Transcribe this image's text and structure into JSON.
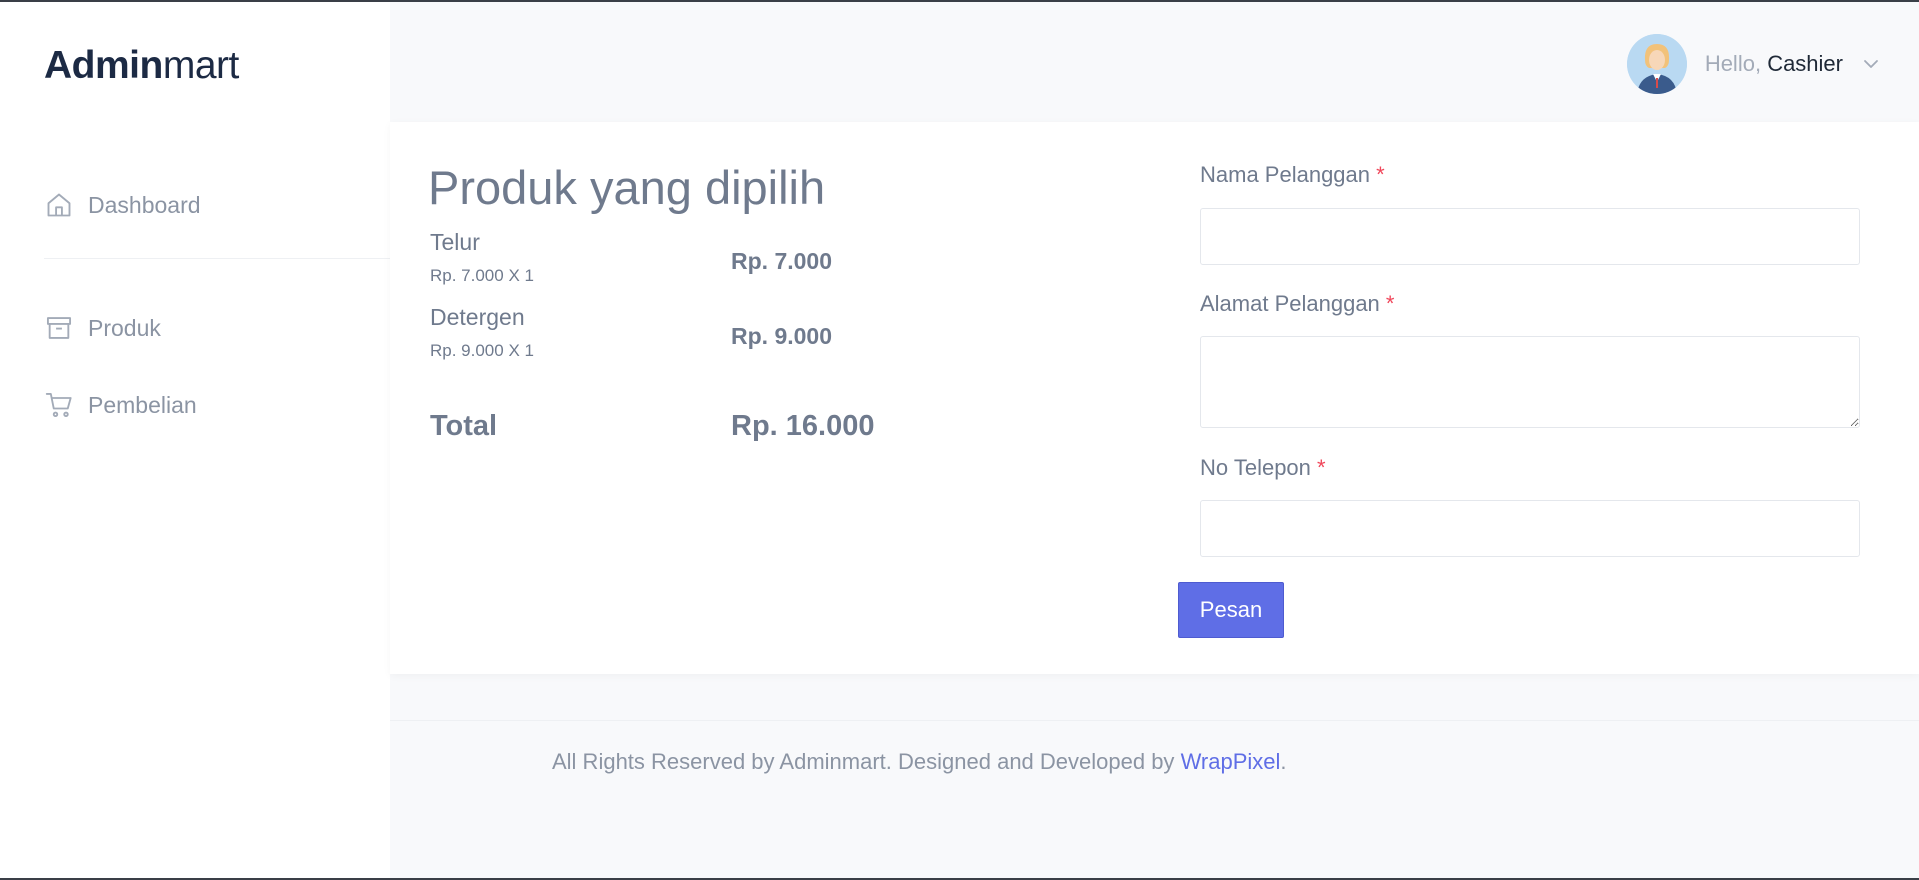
{
  "brand": {
    "bold": "Admin",
    "light": "mart"
  },
  "sidebar": {
    "items": [
      {
        "label": "Dashboard",
        "icon": "home-icon"
      },
      {
        "label": "Produk",
        "icon": "archive-box-icon"
      },
      {
        "label": "Pembelian",
        "icon": "cart-icon"
      }
    ]
  },
  "header": {
    "greeting": "Hello,",
    "user_name": "Cashier",
    "avatar_icon": "user-avatar-icon",
    "dropdown_icon": "chevron-down-icon"
  },
  "order": {
    "title": "Produk yang dipilih",
    "items": [
      {
        "name": "Telur",
        "qty_line": "Rp. 7.000 X 1",
        "subtotal": "Rp. 7.000"
      },
      {
        "name": "Detergen",
        "qty_line": "Rp. 9.000 X 1",
        "subtotal": "Rp. 9.000"
      }
    ],
    "total_label": "Total",
    "total_value": "Rp. 16.000"
  },
  "form": {
    "name_label": "Nama Pelanggan",
    "name_value": "",
    "address_label": "Alamat Pelanggan",
    "address_value": "",
    "phone_label": "No Telepon",
    "phone_value": "",
    "required_mark": "*",
    "submit_label": "Pesan"
  },
  "footer": {
    "text": "All Rights Reserved by Adminmart. Designed and Developed by",
    "link_text": "WrapPixel",
    "suffix": "."
  },
  "colors": {
    "accent": "#5f6ee6",
    "required": "#f0465a",
    "text_muted": "#6f7a8d",
    "brand_dark": "#1c2a44"
  }
}
